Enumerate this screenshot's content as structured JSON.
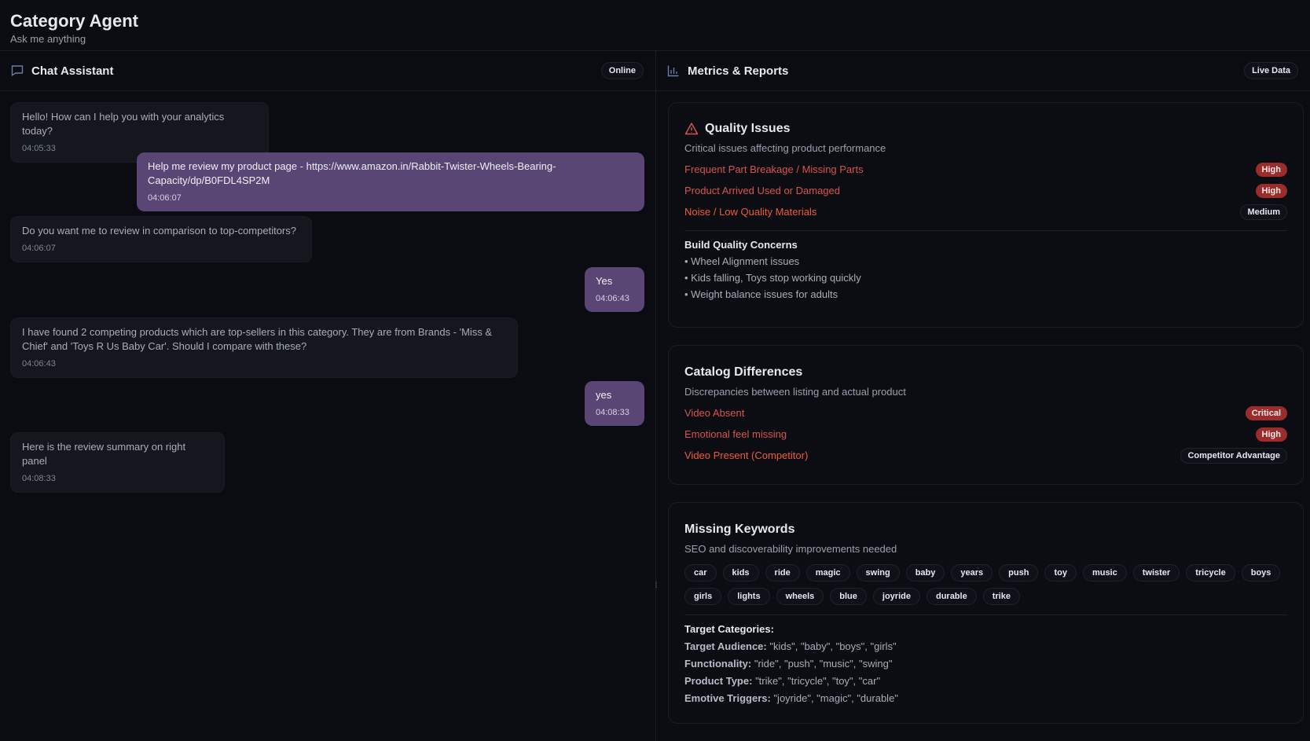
{
  "header": {
    "title": "Category Agent",
    "subtitle": "Ask me anything"
  },
  "chat": {
    "title": "Chat Assistant",
    "status": "Online",
    "icon": "chat-bubble-icon",
    "messages": [
      {
        "role": "bot",
        "text": "Hello! How can I help you with your analytics today?",
        "time": "04:05:33"
      },
      {
        "role": "user",
        "text": "Help me review my product page - https://www.amazon.in/Rabbit-Twister-Wheels-Bearing-Capacity/dp/B0FDL4SP2M",
        "time": "04:06:07"
      },
      {
        "role": "bot",
        "text": "Do you want me to review in comparison to top-competitors?",
        "time": "04:06:07"
      },
      {
        "role": "user",
        "text": "Yes",
        "time": "04:06:43"
      },
      {
        "role": "bot",
        "text": "I have found 2 competing products which are top-sellers in this category. They are from Brands - 'Miss & Chief' and 'Toys R Us Baby Car'. Should I compare with these?",
        "time": "04:06:43"
      },
      {
        "role": "user",
        "text": "yes",
        "time": "04:08:33"
      },
      {
        "role": "bot",
        "text": "Here is the review summary on right panel",
        "time": "04:08:33"
      }
    ]
  },
  "metrics": {
    "title": "Metrics & Reports",
    "status": "Live Data",
    "icon": "bar-chart-icon",
    "quality": {
      "title": "Quality Issues",
      "desc": "Critical issues affecting product performance",
      "issues": [
        {
          "label": "Frequent Part Breakage / Missing Parts",
          "badge": "High"
        },
        {
          "label": "Product Arrived Used or Damaged",
          "badge": "High"
        },
        {
          "label": "Noise / Low Quality Materials",
          "badge": "Medium"
        }
      ],
      "build_title": "Build Quality Concerns",
      "bullets": [
        "• Wheel Alignment issues",
        "• Kids falling, Toys stop working quickly",
        "• Weight balance issues for adults"
      ]
    },
    "catalog": {
      "title": "Catalog Differences",
      "desc": "Discrepancies between listing and actual product",
      "items": [
        {
          "label": "Video Absent",
          "badge": "Critical"
        },
        {
          "label": "Emotional feel missing",
          "badge": "High"
        },
        {
          "label": "Video Present (Competitor)",
          "badge": "Competitor Advantage"
        }
      ]
    },
    "keywords": {
      "title": "Missing Keywords",
      "desc": "SEO and discoverability improvements needed",
      "chips": [
        "car",
        "kids",
        "ride",
        "magic",
        "swing",
        "baby",
        "years",
        "push",
        "toy",
        "music",
        "twister",
        "tricycle",
        "boys",
        "girls",
        "lights",
        "wheels",
        "blue",
        "joyride",
        "durable",
        "trike"
      ],
      "target_title": "Target Categories:",
      "targets": [
        {
          "label": "Target Audience:",
          "value": "\"kids\", \"baby\", \"boys\", \"girls\""
        },
        {
          "label": "Functionality:",
          "value": "\"ride\", \"push\", \"music\", \"swing\""
        },
        {
          "label": "Product Type:",
          "value": "\"trike\", \"tricycle\", \"toy\", \"car\""
        },
        {
          "label": "Emotive Triggers:",
          "value": "\"joyride\", \"magic\", \"durable\""
        }
      ]
    }
  }
}
